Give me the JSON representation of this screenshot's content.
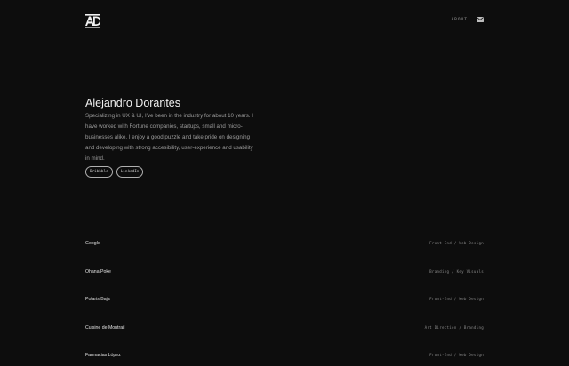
{
  "header": {
    "logo_icon": "ad-monogram-logo",
    "about_label": "ABOUT",
    "mail_icon": "envelope-icon"
  },
  "hero": {
    "name": "Alejandro Dorantes",
    "bio": "Specializing in UX & UI, I've been in the industry for about 10 years. I have worked with Fortune companies, startups, small and micro-businesses alike. I enjoy a good puzzle and take pride on designing and developing with strong accesibility, user-experience and usability in mind.",
    "tags": [
      "Dribbble",
      "LinkedIn"
    ]
  },
  "projects": [
    {
      "name": "Google",
      "tags": "Front-End / Web Design"
    },
    {
      "name": "Ohana Poke",
      "tags": "Branding / Key Visuals"
    },
    {
      "name": "Polaris Baja",
      "tags": "Front-End / Web Design"
    },
    {
      "name": "Cuisine de Montrail",
      "tags": "Art Direction / Branding"
    },
    {
      "name": "Farmacias López",
      "tags": "Front-End / Web Design"
    }
  ],
  "colors": {
    "background": "#0d0d0d",
    "text_primary": "#f0f0f0",
    "text_secondary": "#9d9d9d"
  }
}
